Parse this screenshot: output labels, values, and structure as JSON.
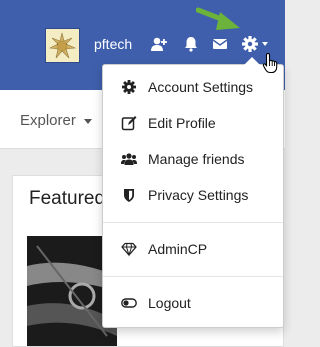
{
  "header": {
    "username": "pftech",
    "icons": [
      "add-friend-icon",
      "bell-icon",
      "envelope-icon",
      "gear-icon"
    ]
  },
  "nav": {
    "explorer_label": "Explorer"
  },
  "main": {
    "featured_title": "Featured"
  },
  "dropdown": {
    "items": [
      {
        "label": "Account Settings",
        "icon": "gear-icon"
      },
      {
        "label": "Edit Profile",
        "icon": "edit-icon"
      },
      {
        "label": "Manage friends",
        "icon": "users-icon"
      },
      {
        "label": "Privacy Settings",
        "icon": "shield-icon"
      },
      {
        "label": "AdminCP",
        "icon": "diamond-icon"
      },
      {
        "label": "Logout",
        "icon": "toggle-icon"
      }
    ]
  },
  "colors": {
    "header_bg": "#3f5fac",
    "arrow": "#6bb33a"
  }
}
